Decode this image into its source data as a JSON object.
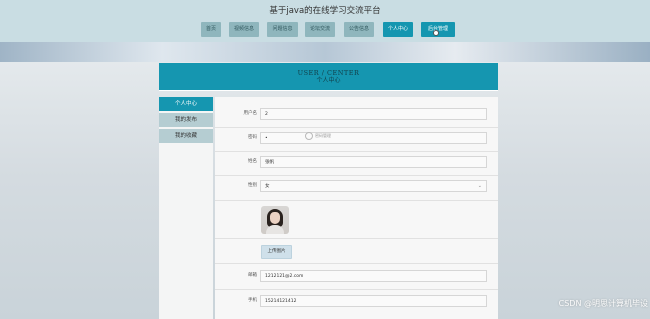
{
  "site": {
    "title": "基于java的在线学习交流平台"
  },
  "nav": {
    "items": [
      {
        "label": "首页",
        "active": false
      },
      {
        "label": "视频信息",
        "active": false
      },
      {
        "label": "问题信息",
        "active": false
      },
      {
        "label": "论坛交流",
        "active": false
      },
      {
        "label": "公告信息",
        "active": false
      },
      {
        "label": "个人中心",
        "active": true
      },
      {
        "label": "后台管理",
        "active": true
      }
    ]
  },
  "header": {
    "en": "USER / CENTER",
    "cn": "个人中心"
  },
  "sidebar": {
    "items": [
      {
        "label": "个人中心",
        "active": true
      },
      {
        "label": "我的发布",
        "active": false
      },
      {
        "label": "我的收藏",
        "active": false
      }
    ]
  },
  "form": {
    "username": {
      "label": "用户名",
      "value": "2"
    },
    "password": {
      "label": "密码",
      "value": "•",
      "hint": "密码管理"
    },
    "name": {
      "label": "姓名",
      "value": "张帆"
    },
    "gender": {
      "label": "性别",
      "value": "女"
    },
    "upload_label": "上传图片",
    "email": {
      "label": "邮箱",
      "value": "1212121@2.com"
    },
    "phone": {
      "label": "手机",
      "value": "15214121412"
    }
  },
  "watermark": "CSDN @明思计算机毕设",
  "colors": {
    "accent": "#1596b0",
    "nav_inactive": "#8fb6bd",
    "sidebar_inactive": "#b5cdd2"
  }
}
